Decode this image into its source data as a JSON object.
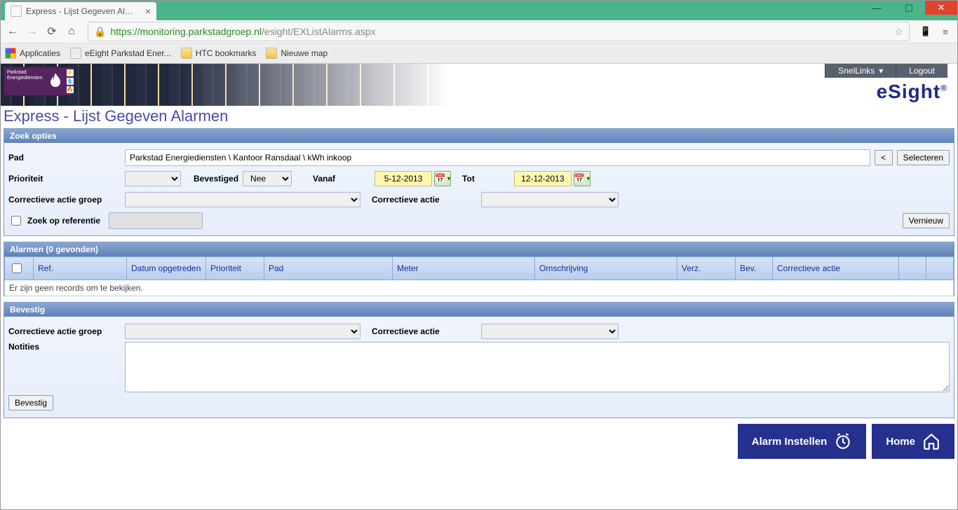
{
  "browser": {
    "tab_title": "Express - Lijst Gegeven Al…",
    "url_secure_host": "https://monitoring.parkstadgroep.nl",
    "url_path": "/esight/EXListAlarms.aspx",
    "bookmarks": {
      "apps": "Applicaties",
      "items": [
        "eEight Parkstad Ener...",
        "HTC bookmarks",
        "Nieuwe map"
      ]
    }
  },
  "topmenu": {
    "snel_links": "SnelLinks",
    "logout": "Logout"
  },
  "brand": "eSight",
  "logo_text": "Parkstad\nEnergiediensten",
  "page_title": "Express - Lijst Gegeven Alarmen",
  "search": {
    "header": "Zoek opties",
    "pad_label": "Pad",
    "pad_value": "Parkstad Energiediensten \\ Kantoor Ransdaal \\ kWh inkoop",
    "back_btn": "<",
    "select_btn": "Selecteren",
    "prioriteit_label": "Prioriteit",
    "bevestigd_label": "Bevestiged",
    "bevestigd_value": "Nee",
    "vanaf_label": "Vanaf",
    "vanaf_value": "5-12-2013",
    "tot_label": "Tot",
    "tot_value": "12-12-2013",
    "corr_group_label": "Correctieve actie groep",
    "corr_group_value": "",
    "corr_actie_label": "Correctieve actie",
    "corr_actie_value": "",
    "zoek_ref_label": "Zoek op referentie",
    "vernieuw_btn": "Vernieuw"
  },
  "grid": {
    "header": "Alarmen (0 gevonden)",
    "columns": [
      "Ref.",
      "Datum opgetreden",
      "Prioriteit",
      "Pad",
      "Meter",
      "Omschrijving",
      "Verz.",
      "Bev.",
      "Correctieve actie"
    ],
    "empty_msg": "Er zijn geen records om te bekijken."
  },
  "confirm": {
    "header": "Bevestig",
    "corr_group_label": "Correctieve actie groep",
    "corr_actie_label": "Correctieve actie",
    "notities_label": "Notities",
    "bevestig_btn": "Bevestig"
  },
  "footer": {
    "alarm_instellen": "Alarm Instellen",
    "home": "Home"
  }
}
